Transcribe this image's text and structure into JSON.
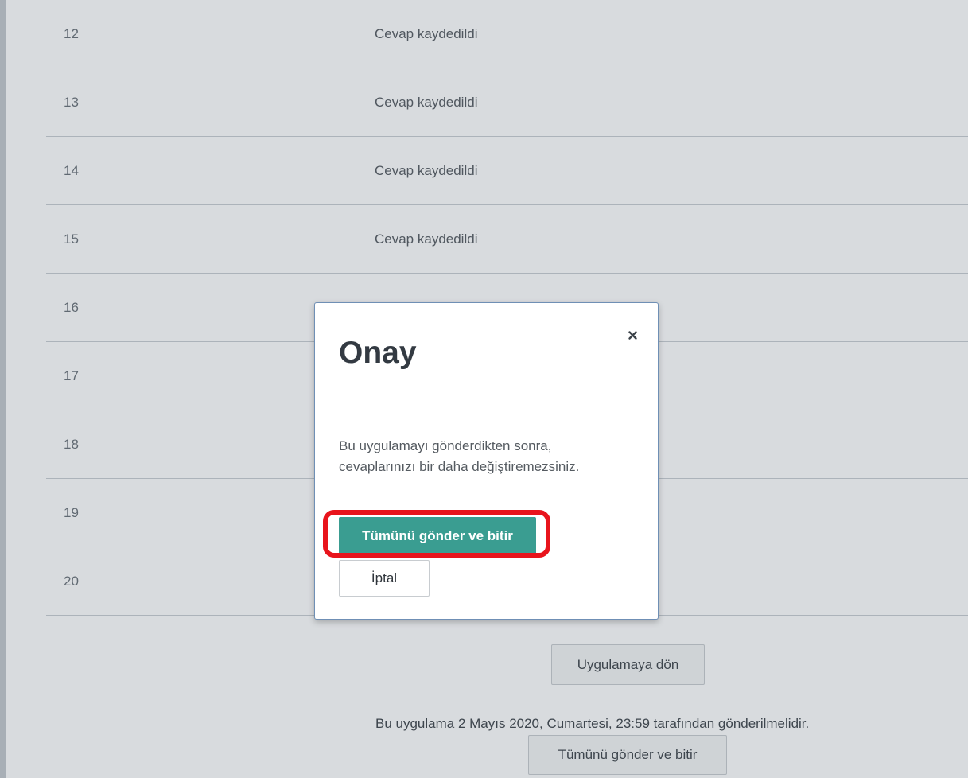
{
  "summary": {
    "rows": [
      {
        "num": "12",
        "status": "Cevap kaydedildi"
      },
      {
        "num": "13",
        "status": "Cevap kaydedildi"
      },
      {
        "num": "14",
        "status": "Cevap kaydedildi"
      },
      {
        "num": "15",
        "status": "Cevap kaydedildi"
      },
      {
        "num": "16",
        "status": ""
      },
      {
        "num": "17",
        "status": ""
      },
      {
        "num": "18",
        "status": ""
      },
      {
        "num": "19",
        "status": ""
      },
      {
        "num": "20",
        "status": ""
      }
    ],
    "back_button": "Uygulamaya dön",
    "deadline_text": "Bu uygulama 2 Mayıs 2020, Cumartesi, 23:59 tarafından gönderilmelidir.",
    "submit_all_button": "Tümünü gönder ve bitir"
  },
  "modal": {
    "title": "Onay",
    "close_icon": "close-icon",
    "message": "Bu uygulamayı gönderdikten sonra, cevaplarınızı bir daha değiştiremezsiniz.",
    "confirm_button": "Tümünü gönder ve bitir",
    "cancel_button": "İptal"
  },
  "colors": {
    "confirm_button_bg": "#3a9d91",
    "highlight": "#e8141c",
    "title": "#333a42"
  }
}
